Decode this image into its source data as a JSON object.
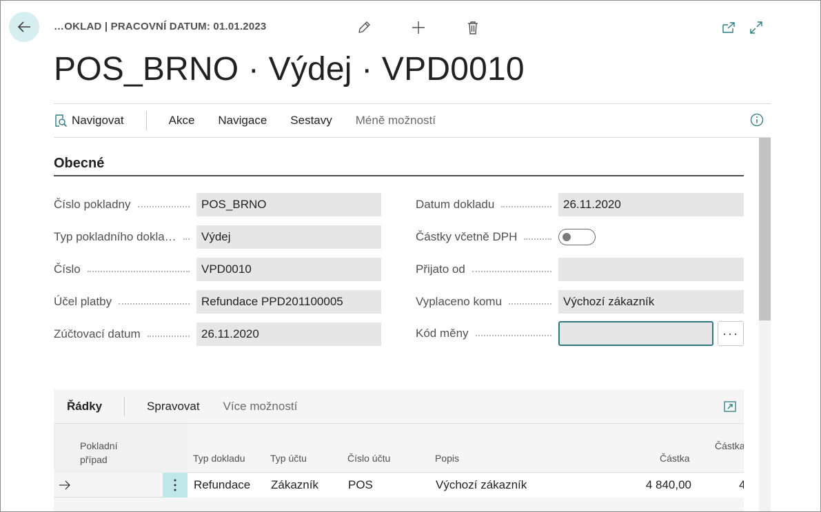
{
  "header": {
    "breadcrumb": "…OKLAD | PRACOVNÍ DATUM: 01.01.2023",
    "title": "POS_BRNO · Výdej · VPD0010"
  },
  "icons": {
    "back": "arrow-left-icon",
    "edit": "pencil-icon",
    "add": "plus-icon",
    "delete": "trash-icon",
    "open_new_window": "open-new-window-icon",
    "expand": "expand-icon",
    "info": "info-icon",
    "navigate": "navigate-icon"
  },
  "actionbar": {
    "navigate": "Navigovat",
    "items": [
      "Akce",
      "Navigace",
      "Sestavy"
    ],
    "less_options": "Méně možností"
  },
  "section": {
    "title": "Obecné"
  },
  "fields_left": [
    {
      "label": "Číslo pokladny",
      "value": "POS_BRNO"
    },
    {
      "label": "Typ pokladního dokla…",
      "value": "Výdej"
    },
    {
      "label": "Číslo",
      "value": "VPD0010"
    },
    {
      "label": "Účel platby",
      "value": "Refundace PPD201100005"
    },
    {
      "label": "Zúčtovací datum",
      "value": "26.11.2020"
    }
  ],
  "fields_right": [
    {
      "label": "Datum dokladu",
      "value": "26.11.2020"
    },
    {
      "label": "Částky včetně DPH",
      "value": "off"
    },
    {
      "label": "Přijato od",
      "value": ""
    },
    {
      "label": "Vyplaceno komu",
      "value": "Výchozí zákazník"
    },
    {
      "label": "Kód měny",
      "value": ""
    }
  ],
  "currency_lookup": "···",
  "lines": {
    "tab": "Řádky",
    "manage": "Spravovat",
    "more_options": "Více možností",
    "columns": {
      "case_line1": "Pokladní",
      "case_line2": "případ",
      "doc_type": "Typ dokladu",
      "account_type": "Typ účtu",
      "account_no": "Číslo účtu",
      "description": "Popis",
      "amount": "Částka",
      "amount2": "Částka"
    },
    "rows": [
      {
        "case": "",
        "doc_type": "Refundace",
        "account_type": "Zákazník",
        "account_no": "POS",
        "description": "Výchozí zákazník",
        "amount": "4 840,00",
        "amount2": "4"
      }
    ]
  },
  "colors": {
    "accent": "#2c7a7e",
    "back_bg": "#d6eef0",
    "kebab_bg": "#bfe6e8",
    "field_bg": "#e6e6e6"
  }
}
